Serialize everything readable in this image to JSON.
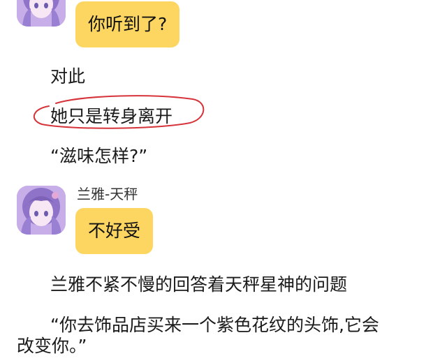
{
  "messages": {
    "bubble_1": "你听到了?",
    "sender_name": "兰雅-天秤",
    "bubble_2": "不好受"
  },
  "narration": {
    "line_1": "对此",
    "line_2": "她只是转身离开",
    "line_3": "“滋味怎样?”",
    "line_4": "兰雅不紧不慢的回答着天秤星神的问题",
    "line_5": "“你去饰品店买来一个紫色花纹的头饰,它会",
    "line_6": "改变你。”"
  },
  "colors": {
    "bubble": "#fdd662",
    "scribble": "#d6333a",
    "avatar_base": "#c9b2ec"
  }
}
